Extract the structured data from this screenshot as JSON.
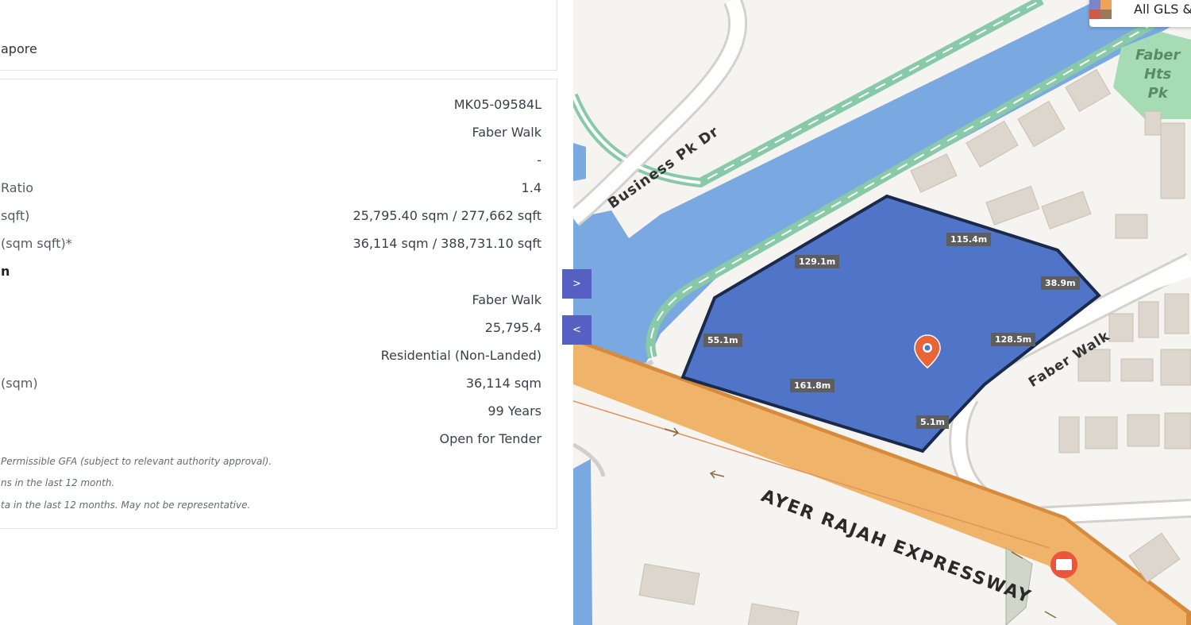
{
  "address_fragment": "apore",
  "details": [
    {
      "label": "",
      "value": "MK05-09584L"
    },
    {
      "label": "",
      "value": "Faber Walk"
    },
    {
      "label": "",
      "value": "-"
    },
    {
      "label": "Ratio",
      "value": "1.4"
    },
    {
      "label": "sqft)",
      "value": "25,795.40 sqm / 277,662 sqft"
    },
    {
      "label": "(sqm sqft)*",
      "value": "36,114 sqm / 388,731.10 sqft"
    }
  ],
  "section_heading": "n",
  "details2": [
    {
      "label": "",
      "value": "Faber Walk"
    },
    {
      "label": "",
      "value": "25,795.4"
    },
    {
      "label": "",
      "value": "Residential (Non-Landed)"
    },
    {
      "label": "(sqm)",
      "value": "36,114 sqm"
    },
    {
      "label": "",
      "value": "99 Years"
    },
    {
      "label": "",
      "value": "Open for Tender"
    }
  ],
  "notes": [
    "Permissible GFA (subject to relevant authority approval).",
    "ns in the last 12 month.",
    "ta in the last 12 months. May not be representative."
  ],
  "toggles": {
    "expand": ">",
    "collapse": "<"
  },
  "map": {
    "legend_label": "All GLS &",
    "road_labels": {
      "business_park": "Business Pk Dr",
      "faber_walk": "Faber Walk",
      "expressway": "AYER RAJAH EXPRESSWAY",
      "park": [
        "Faber",
        "Hts",
        "Pk"
      ]
    },
    "lengths": [
      "115.4m",
      "129.1m",
      "38.9m",
      "55.1m",
      "128.5m",
      "161.8m",
      "5.1m"
    ],
    "colors": {
      "parcel": "#4f74c8",
      "parcel_border": "#1b2a4a",
      "expressway": "#efb36a",
      "water": "#7aa8e0",
      "green": "#88c9a8",
      "pin": "#e8653a"
    }
  }
}
